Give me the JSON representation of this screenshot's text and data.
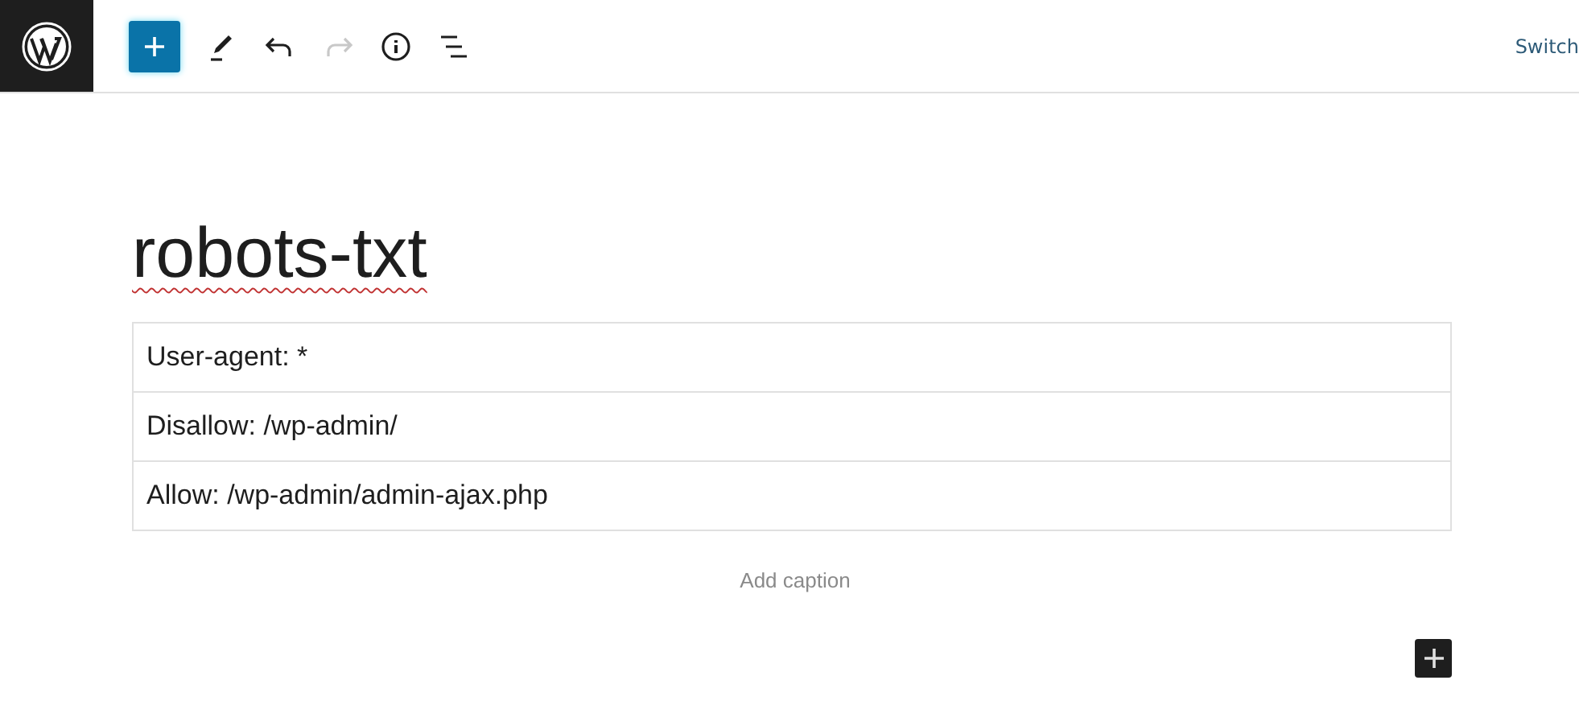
{
  "toolbar": {
    "items": [
      {
        "kind": "inserter",
        "disabled": false
      },
      {
        "kind": "edit",
        "disabled": false
      },
      {
        "kind": "undo",
        "disabled": false
      },
      {
        "kind": "redo",
        "disabled": true
      },
      {
        "kind": "info",
        "disabled": false
      },
      {
        "kind": "outline",
        "disabled": false
      }
    ],
    "switch_link": "Switch"
  },
  "editor": {
    "title": "robots-txt",
    "table": {
      "rows": [
        [
          "User-agent: *"
        ],
        [
          "Disallow: /wp-admin/"
        ],
        [
          "Allow: /wp-admin/admin-ajax.php"
        ]
      ]
    },
    "caption": {
      "placeholder": "Add caption"
    }
  }
}
